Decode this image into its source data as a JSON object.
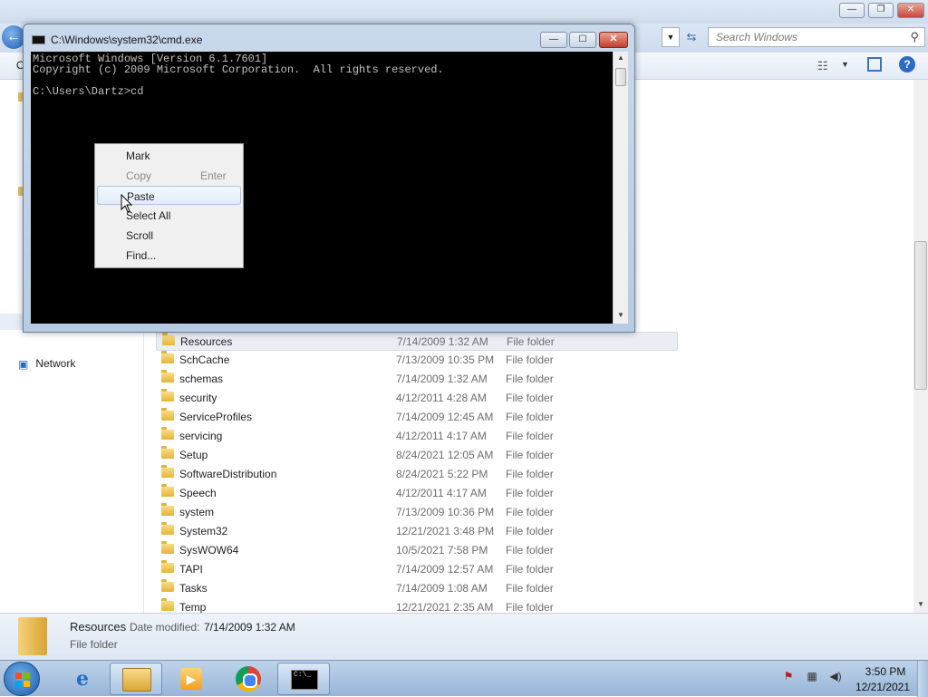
{
  "explorer": {
    "caption_buttons": {
      "minimize": "—",
      "maximize": "❐",
      "close": "✕"
    },
    "back_glyph": "←",
    "search_placeholder": "Search Windows",
    "search_glyph": "⚲",
    "toolbar_organize": "O",
    "view_glyph": "☷",
    "view_arrow": "▼",
    "help_glyph": "?",
    "nav": {
      "network_label": "Network"
    },
    "files": [
      {
        "name": "Resources",
        "date": "7/14/2009 1:32 AM",
        "type": "File folder"
      },
      {
        "name": "SchCache",
        "date": "7/13/2009 10:35 PM",
        "type": "File folder"
      },
      {
        "name": "schemas",
        "date": "7/14/2009 1:32 AM",
        "type": "File folder"
      },
      {
        "name": "security",
        "date": "4/12/2011 4:28 AM",
        "type": "File folder"
      },
      {
        "name": "ServiceProfiles",
        "date": "7/14/2009 12:45 AM",
        "type": "File folder"
      },
      {
        "name": "servicing",
        "date": "4/12/2011 4:17 AM",
        "type": "File folder"
      },
      {
        "name": "Setup",
        "date": "8/24/2021 12:05 AM",
        "type": "File folder"
      },
      {
        "name": "SoftwareDistribution",
        "date": "8/24/2021 5:22 PM",
        "type": "File folder"
      },
      {
        "name": "Speech",
        "date": "4/12/2011 4:17 AM",
        "type": "File folder"
      },
      {
        "name": "system",
        "date": "7/13/2009 10:36 PM",
        "type": "File folder"
      },
      {
        "name": "System32",
        "date": "12/21/2021 3:48 PM",
        "type": "File folder"
      },
      {
        "name": "SysWOW64",
        "date": "10/5/2021 7:58 PM",
        "type": "File folder"
      },
      {
        "name": "TAPI",
        "date": "7/14/2009 12:57 AM",
        "type": "File folder"
      },
      {
        "name": "Tasks",
        "date": "7/14/2009 1:08 AM",
        "type": "File folder"
      },
      {
        "name": "Temp",
        "date": "12/21/2021 2:35 AM",
        "type": "File folder"
      }
    ],
    "selected_file_index": 0,
    "details": {
      "name": "Resources",
      "date_label": "Date modified:",
      "date_value": "7/14/2009 1:32 AM",
      "type": "File folder"
    }
  },
  "cmd": {
    "title": "C:\\Windows\\system32\\cmd.exe",
    "caption_buttons": {
      "minimize": "—",
      "maximize": "☐",
      "close": "✕"
    },
    "lines": [
      "Microsoft Windows [Version 6.1.7601]",
      "Copyright (c) 2009 Microsoft Corporation.  All rights reserved.",
      "",
      "C:\\Users\\Dartz>cd"
    ]
  },
  "context_menu": {
    "items": [
      {
        "label": "Mark",
        "shortcut": "",
        "disabled": false,
        "highlight": false
      },
      {
        "label": "Copy",
        "shortcut": "Enter",
        "disabled": true,
        "highlight": false
      },
      {
        "label": "Paste",
        "shortcut": "",
        "disabled": false,
        "highlight": true
      },
      {
        "label": "Select All",
        "shortcut": "",
        "disabled": false,
        "highlight": false
      },
      {
        "label": "Scroll",
        "shortcut": "",
        "disabled": false,
        "highlight": false
      },
      {
        "label": "Find...",
        "shortcut": "",
        "disabled": false,
        "highlight": false
      }
    ]
  },
  "taskbar": {
    "ie_glyph": "e",
    "media_glyph": "▶",
    "cmd_glyph": "C:\\_",
    "tray": {
      "flag": "⚑",
      "network": "▦",
      "volume": "◀)"
    },
    "clock_time": "3:50 PM",
    "clock_date": "12/21/2021"
  }
}
